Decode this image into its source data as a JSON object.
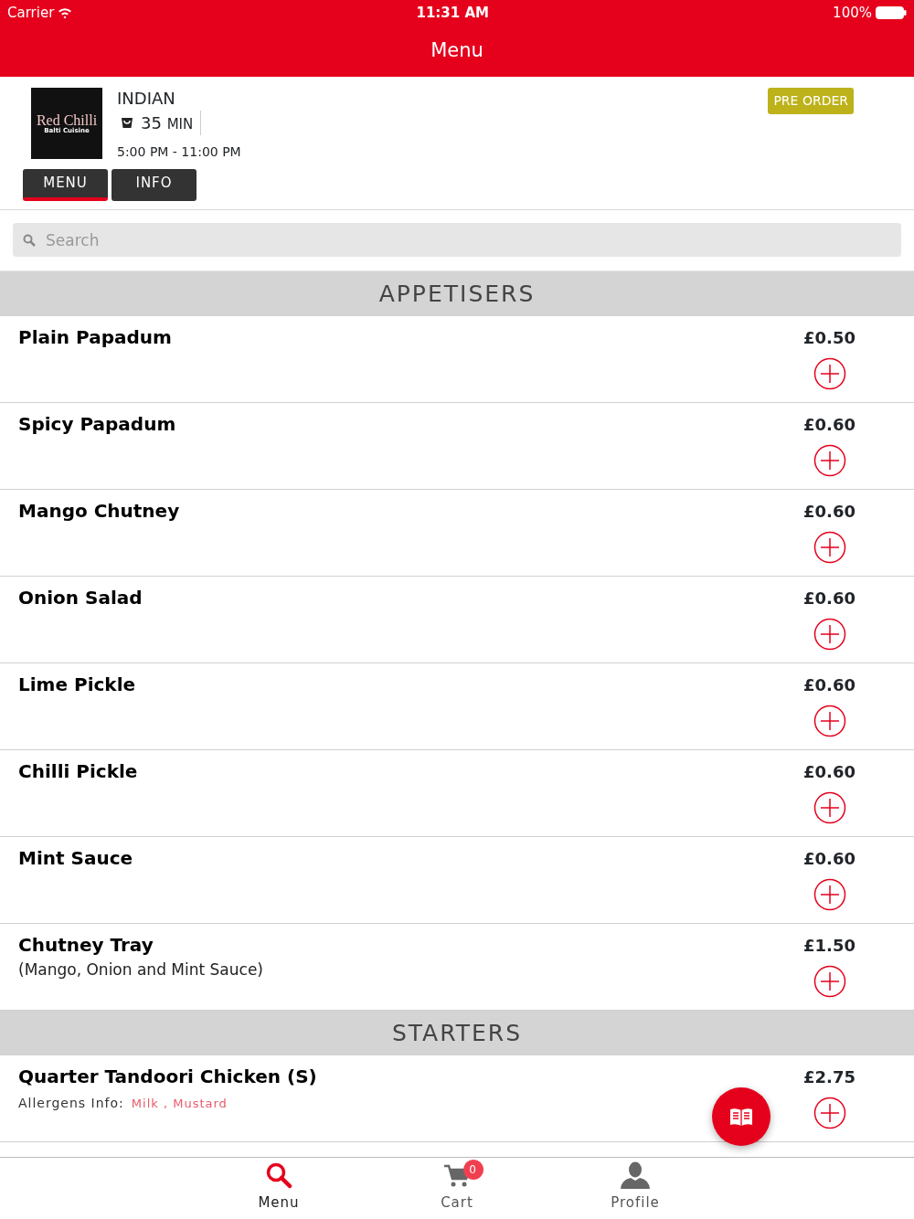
{
  "status_bar": {
    "carrier": "Carrier",
    "time": "11:31 AM",
    "battery": "100%"
  },
  "nav_bar": {
    "title": "Menu"
  },
  "restaurant": {
    "cuisine": "INDIAN",
    "delivery_time": "35",
    "delivery_unit": "MIN",
    "hours": "5:00 PM - 11:00 PM",
    "badge": "PRE ORDER",
    "logo_text": "Red Chilli",
    "logo_subtext": "Balti Cuisine"
  },
  "tabs": [
    {
      "label": "MENU",
      "selected": true
    },
    {
      "label": "INFO",
      "selected": false
    }
  ],
  "search": {
    "placeholder": "Search"
  },
  "sections": [
    {
      "title": "APPETISERS",
      "items": [
        {
          "name": "Plain Papadum",
          "price": "£0.50"
        },
        {
          "name": "Spicy Papadum",
          "price": "£0.60"
        },
        {
          "name": "Mango Chutney",
          "price": "£0.60"
        },
        {
          "name": "Onion Salad",
          "price": "£0.60"
        },
        {
          "name": "Lime Pickle",
          "price": "£0.60"
        },
        {
          "name": "Chilli Pickle",
          "price": "£0.60"
        },
        {
          "name": "Mint Sauce",
          "price": "£0.60"
        },
        {
          "name": "Chutney Tray",
          "description": "(Mango, Onion and Mint Sauce)",
          "price": "£1.50"
        }
      ]
    },
    {
      "title": "STARTERS",
      "items": [
        {
          "name": "Quarter Tandoori Chicken (S)",
          "allergens_label": "Allergens Info:",
          "allergens": "Milk , Mustard",
          "price": "£2.75"
        }
      ]
    }
  ],
  "bottom_tabs": [
    {
      "label": "Menu",
      "selected": true
    },
    {
      "label": "Cart",
      "badge": "0",
      "selected": false
    },
    {
      "label": "Profile",
      "selected": false
    }
  ]
}
